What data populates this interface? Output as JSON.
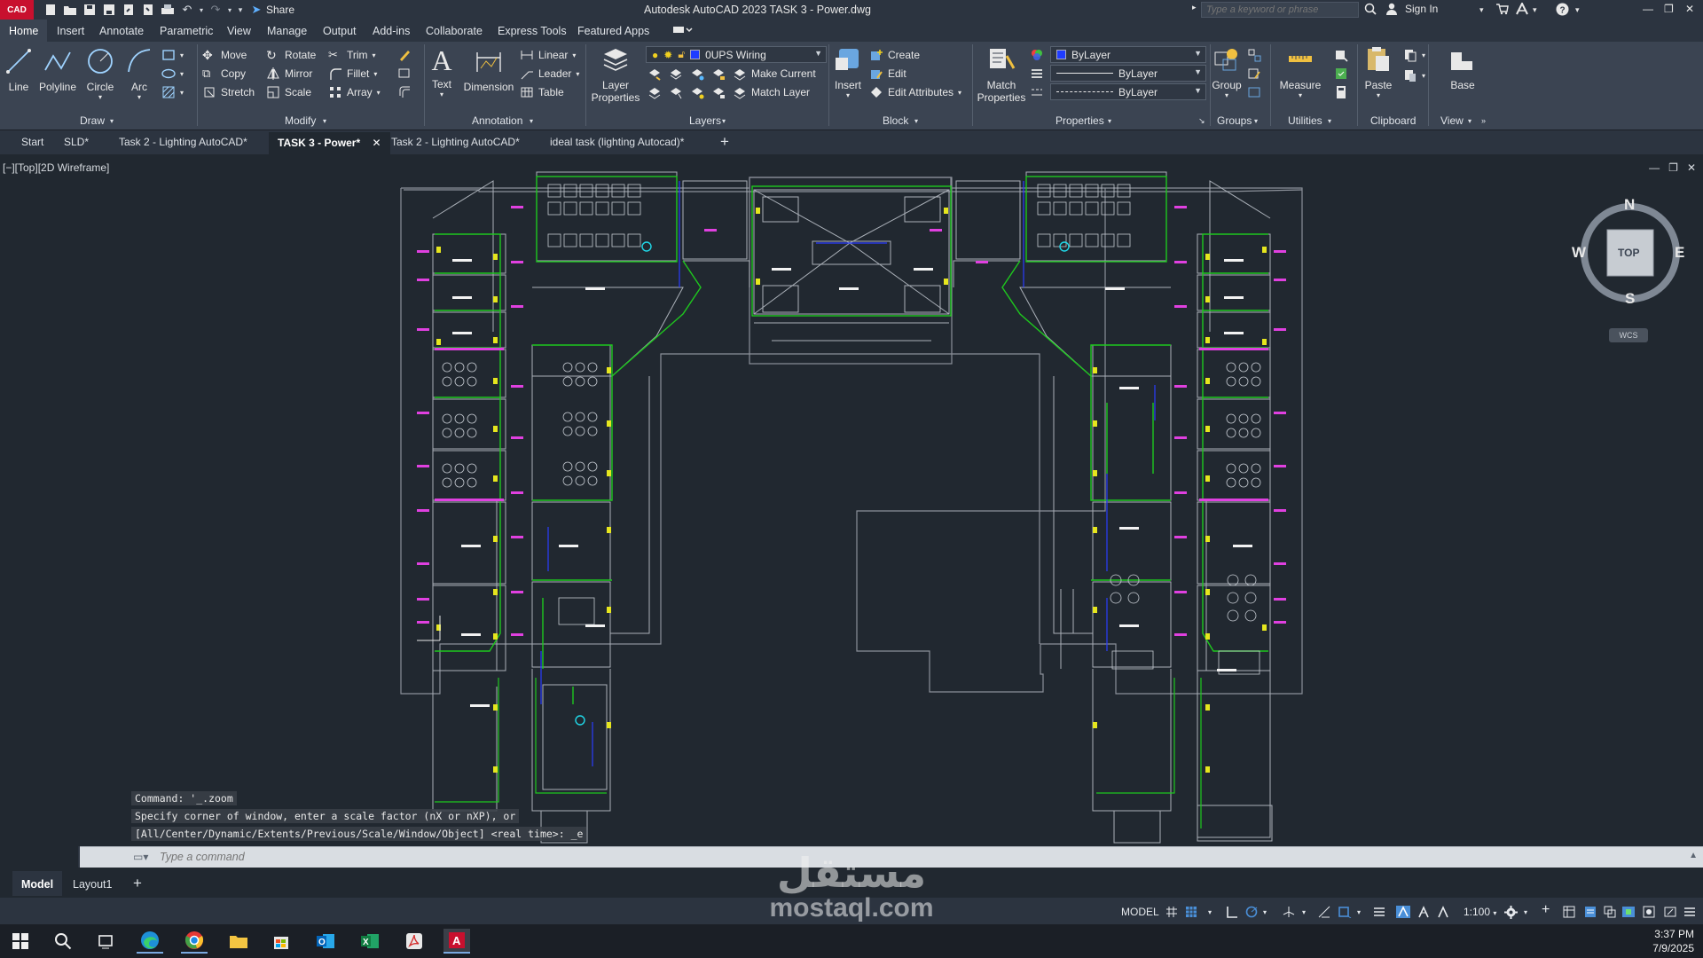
{
  "app": {
    "logo_text": "CAD",
    "window_title": "Autodesk AutoCAD 2023   TASK 3 - Power.dwg",
    "share_label": "Share",
    "search_placeholder": "Type a keyword or phrase",
    "sign_in_label": "Sign In"
  },
  "ribbon_tabs": [
    "Home",
    "Insert",
    "Annotate",
    "Parametric",
    "View",
    "Manage",
    "Output",
    "Add-ins",
    "Collaborate",
    "Express Tools",
    "Featured Apps"
  ],
  "ribbon": {
    "draw": {
      "title": "Draw",
      "line": "Line",
      "polyline": "Polyline",
      "circle": "Circle",
      "arc": "Arc"
    },
    "modify": {
      "title": "Modify",
      "move": "Move",
      "rotate": "Rotate",
      "trim": "Trim",
      "copy": "Copy",
      "mirror": "Mirror",
      "fillet": "Fillet",
      "stretch": "Stretch",
      "scale": "Scale",
      "array": "Array"
    },
    "annotation": {
      "title": "Annotation",
      "text": "Text",
      "dimension": "Dimension",
      "linear": "Linear",
      "leader": "Leader",
      "table": "Table"
    },
    "layers": {
      "title": "Layers",
      "layer_properties": "Layer Properties",
      "current_layer": "0UPS Wiring",
      "make_current": "Make Current",
      "match_layer": "Match Layer"
    },
    "block": {
      "title": "Block",
      "insert": "Insert",
      "create": "Create",
      "edit": "Edit",
      "edit_attributes": "Edit Attributes"
    },
    "properties": {
      "title": "Properties",
      "match_properties": "Match Properties",
      "color": "ByLayer",
      "lineweight": "ByLayer",
      "linetype": "ByLayer"
    },
    "groups": {
      "title": "Groups",
      "group": "Group"
    },
    "utilities": {
      "title": "Utilities",
      "measure": "Measure"
    },
    "clipboard": {
      "title": "Clipboard",
      "paste": "Paste"
    },
    "view": {
      "title": "View",
      "base": "Base"
    }
  },
  "file_tabs": [
    "Start",
    "SLD*",
    "Task 2 - Lighting AutoCAD*",
    "TASK 3 - Power*",
    "Task 2 - Lighting AutoCAD*",
    "ideal task (lighting Autocad)*"
  ],
  "viewport": {
    "label": "[−][Top][2D Wireframe]",
    "viewcube": {
      "north": "N",
      "south": "S",
      "east": "E",
      "west": "W",
      "face": "TOP",
      "ucs": "WCS"
    }
  },
  "command": {
    "history": [
      "Command: '_.zoom",
      "Specify corner of window, enter a scale factor (nX or nXP), or",
      "[All/Center/Dynamic/Extents/Previous/Scale/Window/Object] <real time>: _e"
    ],
    "placeholder": "Type a command"
  },
  "layout_tabs": [
    "Model",
    "Layout1"
  ],
  "status": {
    "model_label": "MODEL",
    "scale": "1:100"
  },
  "taskbar": {
    "time": "3:37 PM",
    "date": "7/9/2025"
  },
  "watermark": {
    "arabic": "مستقل",
    "latin": "mostaql.com"
  },
  "colors": {
    "accent_layer": "#1f3cff",
    "wiring_green": "#1ec81e",
    "annotation_magenta": "#e040e0",
    "outlet_yellow": "#e6e61e"
  }
}
